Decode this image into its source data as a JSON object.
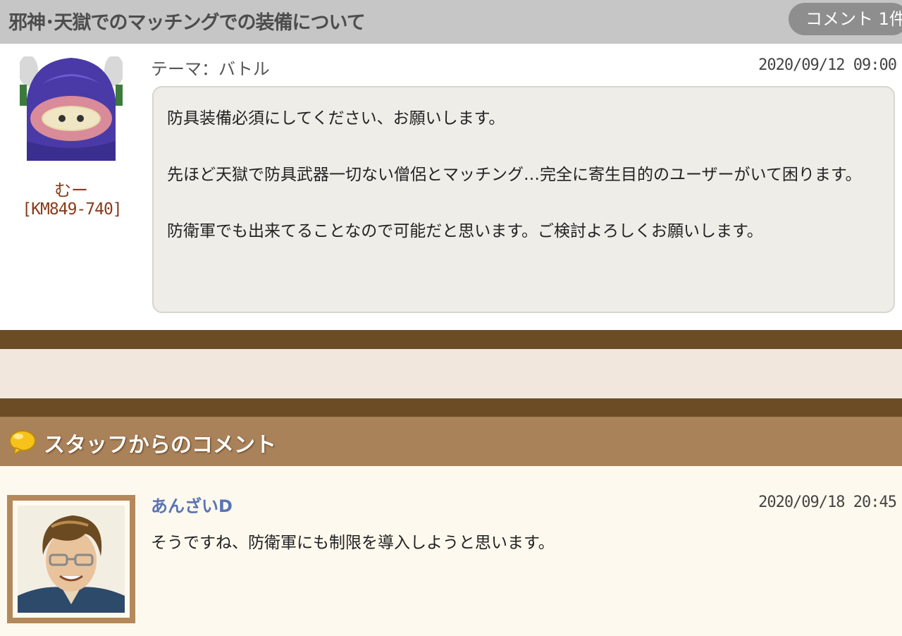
{
  "post": {
    "title": "邪神･天獄でのマッチングでの装備について",
    "comment_count": "コメント 1件",
    "theme": "テーマ：バトル",
    "date": "2020/09/12 09:00",
    "author": {
      "name": "むー",
      "id": "[KM849-740]"
    },
    "body": [
      "防具装備必須にしてください、お願いします。",
      "先ほど天獄で防具武器一切ない僧侶とマッチング…完全に寄生目的のユーザーがいて困ります。",
      "防衛軍でも出来てることなので可能だと思います。ご検討よろしくお願いします。"
    ]
  },
  "staff": {
    "section_title": "スタッフからのコメント",
    "section_icon": "speech-bubble-icon",
    "name": "あんざいD",
    "date": "2020/09/18 20:45",
    "comment": "そうですね、防衛軍にも制限を導入しようと思います。"
  },
  "colors": {
    "header_bg": "#c6c6c6",
    "band_dark": "#6b4c25",
    "staff_header_bg": "#a9825a",
    "staff_name": "#5a74b5",
    "user_name": "#8a3b1b"
  }
}
